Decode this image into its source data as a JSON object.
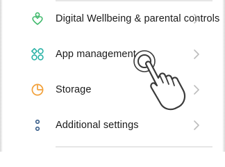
{
  "settings_list": {
    "items": [
      {
        "id": "digital-wellbeing",
        "icon": "digital-wellbeing-icon",
        "label": "Digital Wellbeing & parental controls"
      },
      {
        "id": "app-management",
        "icon": "app-management-icon",
        "label": "App management"
      },
      {
        "id": "storage",
        "icon": "storage-icon",
        "label": "Storage"
      },
      {
        "id": "additional-settings",
        "icon": "additional-settings-icon",
        "label": "Additional settings"
      }
    ]
  },
  "colors": {
    "wellbeing_icon": "#3fb96b",
    "app_management_icon": "#2cb3a7",
    "storage_icon": "#f2a13b",
    "additional_settings_icon": "#3a5f8a",
    "text": "#1a1a1a",
    "chevron": "#bdbdbd"
  },
  "gesture": {
    "icon": "tap-hand-icon",
    "target": "app-management"
  }
}
